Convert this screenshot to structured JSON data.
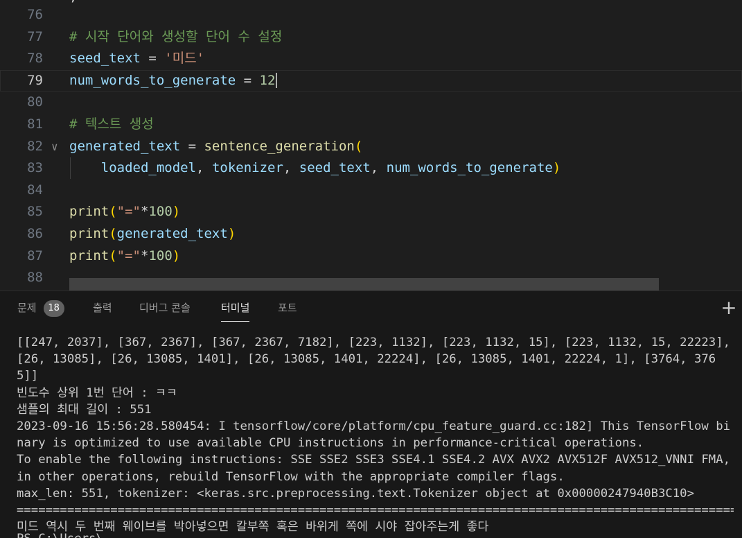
{
  "editor": {
    "partial_top": ",",
    "lines": [
      {
        "num": "76",
        "tokens": []
      },
      {
        "num": "77",
        "tokens": [
          {
            "t": "# 시작 단어와 생성할 단어 수 설정",
            "c": "cm"
          }
        ]
      },
      {
        "num": "78",
        "tokens": [
          {
            "t": "seed_text",
            "c": "var"
          },
          {
            "t": " = ",
            "c": "op"
          },
          {
            "t": "'미드'",
            "c": "str"
          }
        ]
      },
      {
        "num": "79",
        "tokens": [
          {
            "t": "num_words_to_generate",
            "c": "var"
          },
          {
            "t": " = ",
            "c": "op"
          },
          {
            "t": "12",
            "c": "num"
          }
        ]
      },
      {
        "num": "80",
        "tokens": []
      },
      {
        "num": "81",
        "tokens": [
          {
            "t": "# 텍스트 생성",
            "c": "cm"
          }
        ]
      },
      {
        "num": "82",
        "tokens": [
          {
            "t": "generated_text",
            "c": "var"
          },
          {
            "t": " = ",
            "c": "op"
          },
          {
            "t": "sentence_generation",
            "c": "fn"
          },
          {
            "t": "(",
            "c": "paren"
          }
        ]
      },
      {
        "num": "83",
        "tokens": [
          {
            "t": "    ",
            "c": "op"
          },
          {
            "t": "loaded_model",
            "c": "var"
          },
          {
            "t": ", ",
            "c": "op"
          },
          {
            "t": "tokenizer",
            "c": "var"
          },
          {
            "t": ", ",
            "c": "op"
          },
          {
            "t": "seed_text",
            "c": "var"
          },
          {
            "t": ", ",
            "c": "op"
          },
          {
            "t": "num_words_to_generate",
            "c": "var"
          },
          {
            "t": ")",
            "c": "paren"
          }
        ]
      },
      {
        "num": "84",
        "tokens": []
      },
      {
        "num": "85",
        "tokens": [
          {
            "t": "print",
            "c": "fn"
          },
          {
            "t": "(",
            "c": "paren"
          },
          {
            "t": "\"=\"",
            "c": "str"
          },
          {
            "t": "*",
            "c": "op"
          },
          {
            "t": "100",
            "c": "num"
          },
          {
            "t": ")",
            "c": "paren"
          }
        ]
      },
      {
        "num": "86",
        "tokens": [
          {
            "t": "print",
            "c": "fn"
          },
          {
            "t": "(",
            "c": "paren"
          },
          {
            "t": "generated_text",
            "c": "var"
          },
          {
            "t": ")",
            "c": "paren"
          }
        ]
      },
      {
        "num": "87",
        "tokens": [
          {
            "t": "print",
            "c": "fn"
          },
          {
            "t": "(",
            "c": "paren"
          },
          {
            "t": "\"=\"",
            "c": "str"
          },
          {
            "t": "*",
            "c": "op"
          },
          {
            "t": "100",
            "c": "num"
          },
          {
            "t": ")",
            "c": "paren"
          }
        ]
      },
      {
        "num": "88",
        "tokens": []
      }
    ],
    "current_line": "79",
    "fold_line": "82",
    "indent_guide_line": "83"
  },
  "panel": {
    "tabs": {
      "problems": "문제",
      "problems_count": "18",
      "output": "출력",
      "debug_console": "디버그 콘솔",
      "terminal": "터미널",
      "ports": "포트"
    },
    "active_tab": "terminal",
    "add_icon": "plus-icon"
  },
  "terminal": {
    "lines": [
      "[[247, 2037], [367, 2367], [367, 2367, 7182], [223, 1132], [223, 1132, 15], [223, 1132, 15, 22223], [26, 13085], [26, 13085, 1401], [26, 13085, 1401, 22224], [26, 13085, 1401, 22224, 1], [3764, 3765]]",
      "빈도수 상위 1번 단어 : ㅋㅋ",
      "샘플의 최대 길이 : 551",
      "2023-09-16 15:56:28.580454: I tensorflow/core/platform/cpu_feature_guard.cc:182] This TensorFlow binary is optimized to use available CPU instructions in performance-critical operations.",
      "To enable the following instructions: SSE SSE2 SSE3 SSE4.1 SSE4.2 AVX AVX2 AVX512F AVX512_VNNI FMA, in other operations, rebuild TensorFlow with the appropriate compiler flags.",
      "max_len: 551, tokenizer: <keras.src.preprocessing.text.Tokenizer object at 0x00000247940B3C10>",
      "====================================================================================================",
      "미드 역시 두 번째 웨이브를 박아넣으면 칼부쪽 혹은 바위게 쪽에 시야 잡아주는게 좋다",
      "===================================================================================================="
    ],
    "partial_bottom": "PS C:\\Users\\..."
  }
}
